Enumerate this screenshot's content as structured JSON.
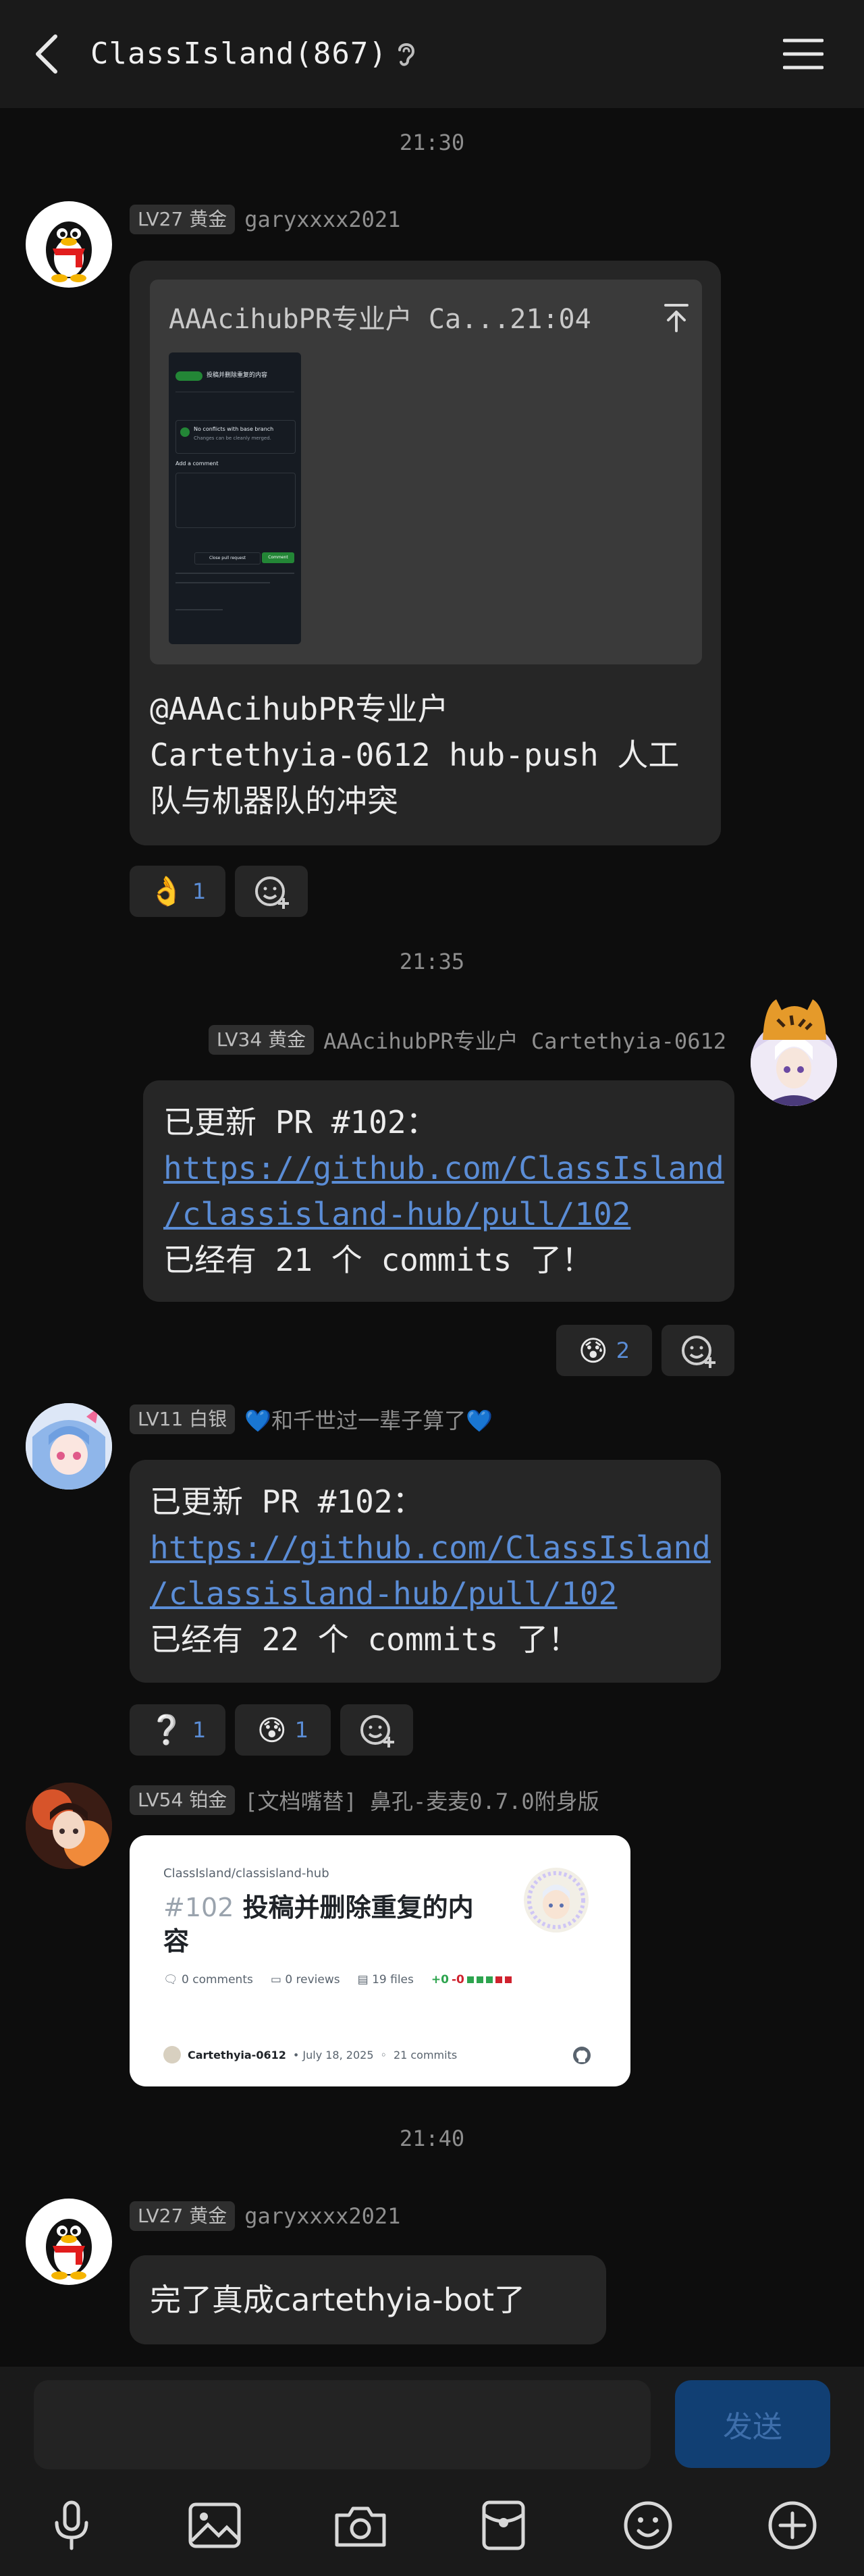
{
  "header": {
    "title": "ClassIsland(867)",
    "back_icon": "chevron-left-icon",
    "ear_icon": "ear-icon",
    "menu_icon": "hamburger-menu-icon"
  },
  "timestamps": [
    "21:30",
    "21:35",
    "21:40"
  ],
  "messages": [
    {
      "level": "LV27 黄金",
      "sender": "garyxxxx2021",
      "quote": {
        "header": "AAAcihubPR专业户 Ca...21:04",
        "thumbnail": {
          "pr_title": "投稿并删除重复的内容",
          "no_conflicts": "No conflicts with base branch",
          "changes_note": "Changes can be cleanly merged.",
          "add_comment": "Add a comment",
          "close_pr": "Close pull request",
          "comment": "Comment"
        }
      },
      "text_lines": [
        "@AAAcihubPR专业户",
        "Cartethyia-0612 hub-push 人工",
        "队与机器队的冲突"
      ],
      "reactions": [
        {
          "emoji": "👌",
          "count": "1"
        }
      ]
    },
    {
      "level": "LV34 黄金",
      "sender": "AAAcihubPR专业户 Cartethyia-0612",
      "line1": "已更新 PR #102：",
      "link_line1": "https://github.com/ClassIsland",
      "link_line2": "/classisland-hub/pull/102",
      "line3": "已经有 21 个 commits 了！",
      "reactions": [
        {
          "emoji": "😰",
          "count": "2"
        }
      ]
    },
    {
      "level": "LV11 白银",
      "sender": "💙和千世过一辈子算了💙",
      "line1": "已更新 PR #102：",
      "link_line1": "https://github.com/ClassIsland",
      "link_line2": "/classisland-hub/pull/102",
      "line3": "已经有 22 个 commits 了！",
      "reactions": [
        {
          "emoji": "❔",
          "count": "1"
        },
        {
          "emoji": "😰",
          "count": "1"
        }
      ]
    },
    {
      "level": "LV54 铂金",
      "sender": "[文档嘴替] 鼻孔-麦麦0.7.0附身版",
      "card": {
        "repo": "ClassIsland/classisland-hub",
        "pr_number": "#102",
        "pr_title_line1": "投稿并删除重复的内",
        "pr_title_line2": "容",
        "comments": "0 comments",
        "reviews": "0 reviews",
        "files": "19 files",
        "diff_plus": "+0",
        "diff_minus": "-0",
        "author": "Cartethyia-0612",
        "date": "• July 18, 2025",
        "commits": "21 commits"
      }
    },
    {
      "level": "LV27 黄金",
      "sender": "garyxxxx2021",
      "text": "完了真成cartethyia-bot了"
    }
  ],
  "input": {
    "placeholder": "",
    "send_label": "发送"
  },
  "toolbar": [
    "microphone-icon",
    "image-icon",
    "camera-icon",
    "red-packet-icon",
    "emoji-icon",
    "plus-circle-icon"
  ],
  "colors": {
    "background": "#0d0d0d",
    "bubble": "#262626",
    "link": "#5b8dd6",
    "send": "#113f73",
    "diff_green": "#2da44e",
    "diff_red": "#cf222e"
  }
}
